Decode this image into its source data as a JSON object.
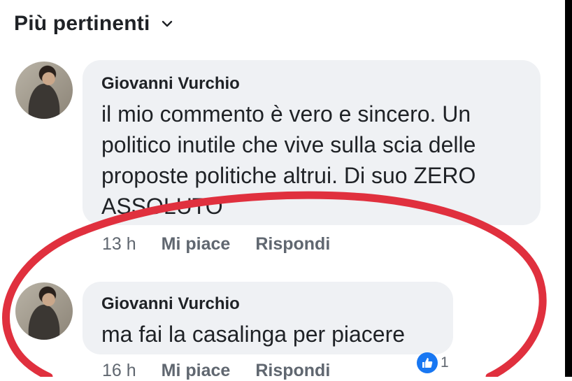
{
  "sort": {
    "label": "Più pertinenti"
  },
  "comments": [
    {
      "author": "Giovanni Vurchio",
      "lines": [
        "il mio commento è vero e sincero. Un",
        "politico inutile che vive sulla scia delle",
        "proposte politiche altrui. Di suo ZERO",
        "ASSOLUTO"
      ],
      "time": "13 h",
      "like": "Mi piace",
      "reply": "Rispondi"
    },
    {
      "author": "Giovanni Vurchio",
      "lines": [
        "ma fai la casalinga per piacere"
      ],
      "time": "16 h",
      "like": "Mi piace",
      "reply": "Rispondi",
      "reaction_count": "1"
    }
  ],
  "colors": {
    "bubble": "#eff1f4",
    "meta": "#606770",
    "annotation": "#e0303e",
    "like": "#1877f2"
  },
  "icons": {
    "sort": "chevron-down-icon",
    "reaction": "like-icon"
  }
}
